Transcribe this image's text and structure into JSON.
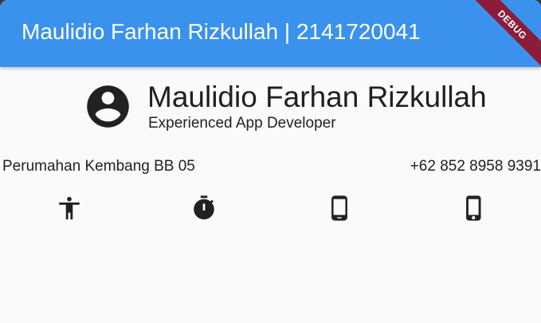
{
  "app_bar": {
    "title": "Maulidio Farhan Rizkullah | 2141720041",
    "color": "#3a92ed"
  },
  "debug_banner": {
    "label": "DEBUG",
    "color": "#8b1d3a"
  },
  "profile": {
    "icon": "account-circle-icon",
    "name": "Maulidio Farhan Rizkullah",
    "role": "Experienced App Developer"
  },
  "contact": {
    "address": "Perumahan Kembang BB 05",
    "phone": "+62 852 8958 9391"
  },
  "action_icons": [
    "accessibility-icon",
    "timer-icon",
    "phone-android-icon",
    "phone-iphone-icon"
  ]
}
